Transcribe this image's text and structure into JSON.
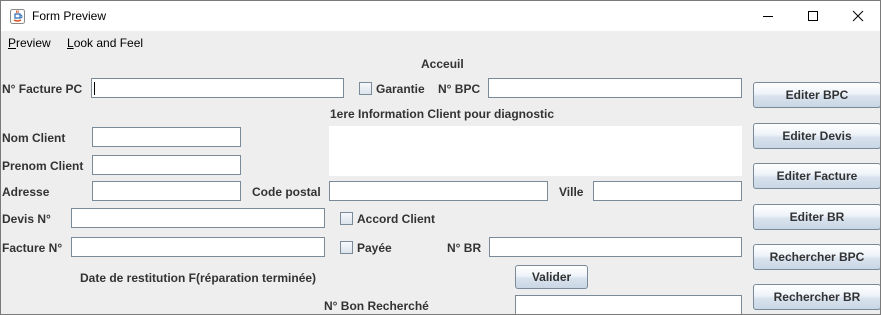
{
  "window": {
    "title": "Form Preview",
    "icons": [
      "java-app-icon",
      "minimize-icon",
      "maximize-icon",
      "close-icon"
    ]
  },
  "menu": {
    "items": [
      "Preview",
      "Look and Feel"
    ]
  },
  "form": {
    "section_title": "Acceuil",
    "facture_pc_label": "N° Facture PC",
    "facture_pc_value": "",
    "garantie_label": "Garantie",
    "bpc_label": "N° BPC",
    "bpc_value": "",
    "client_info_title": "1ere Information Client pour diagnostic",
    "client_info_value": "",
    "nom_label": "Nom Client",
    "nom_value": "",
    "prenom_label": "Prenom Client",
    "prenom_value": "",
    "adresse_label": "Adresse",
    "adresse_value": "",
    "code_postal_label": "Code postal",
    "code_postal_value": "",
    "ville_label": "Ville",
    "ville_value": "",
    "devis_label": "Devis N°",
    "devis_value": "",
    "accord_label": "Accord Client",
    "facture_label": "Facture N°",
    "facture_value": "",
    "payee_label": "Payée",
    "br_label": "N° BR",
    "br_value": "",
    "restitution_label": "Date de restitution F(réparation terminée)",
    "valider_label": "Valider",
    "bon_recherche_label": "N° Bon Recherché",
    "bon_recherche_value": ""
  },
  "side_buttons": {
    "editer_bpc": "Editer BPC",
    "editer_devis": "Editer Devis",
    "editer_facture": "Editer Facture",
    "editer_br": "Editer BR",
    "rechercher_bpc": "Rechercher BPC",
    "rechercher_br": "Rechercher BR"
  }
}
